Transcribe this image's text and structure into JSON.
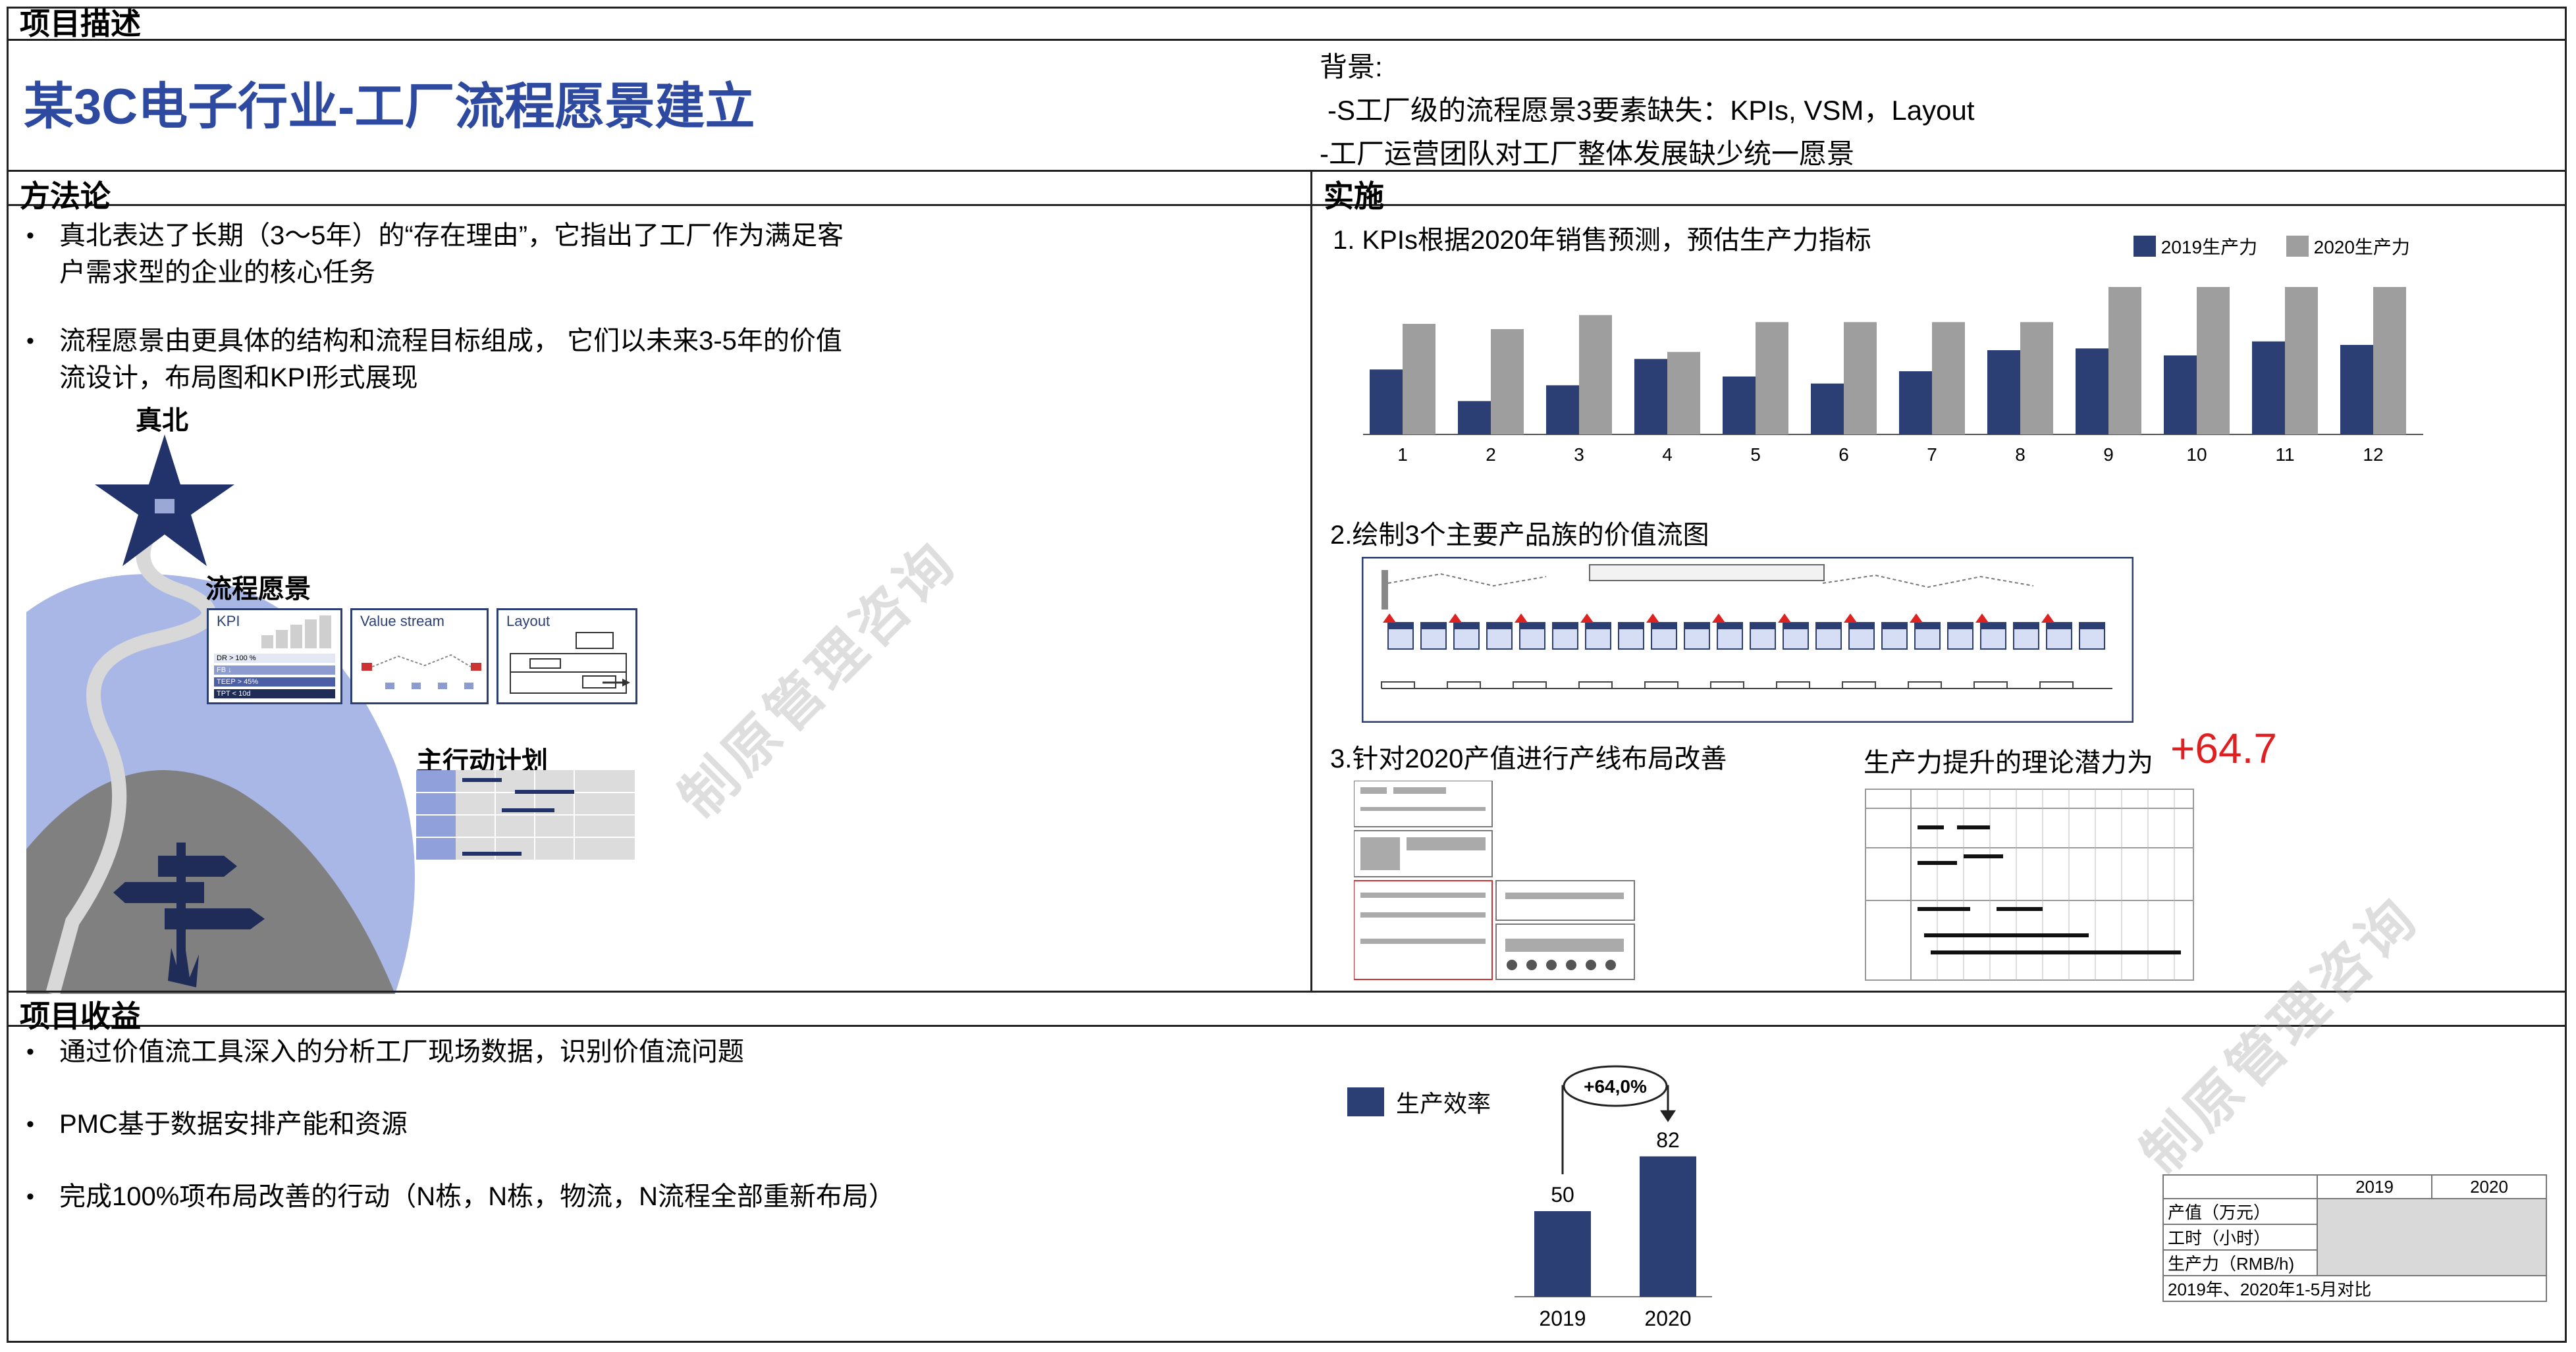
{
  "header": {
    "section_label": "项目描述",
    "title": "某3C电子行业-工厂流程愿景建立",
    "background_label": "背景:",
    "background_items": [
      "-S工厂级的流程愿景3要素缺失：KPIs, VSM，Layout",
      "-工厂运营团队对工厂整体发展缺少统一愿景"
    ]
  },
  "methodology": {
    "section_label": "方法论",
    "bullets": [
      "真北表达了长期（3～5年）的“存在理由”，它指出了工厂作为满足客户需求型的企业的核心任务",
      "流程愿景由更具体的结构和流程目标组成， 它们以未来3-5年的价值流设计，布局图和KPI形式展现"
    ],
    "true_north_label": "真北",
    "vision_label": "流程愿景",
    "vision_cards": [
      "KPI",
      "Value stream",
      "Layout"
    ],
    "kpi_rows": [
      "DR > 100 %",
      "FB ↓",
      "TEEP > 45%",
      "TPT < 10d"
    ],
    "action_plan_label": "主行动计划"
  },
  "implementation": {
    "section_label": "实施",
    "step1": "1. KPIs根据2020年销售预测，预估生产力指标",
    "step2": "2.绘制3个主要产品族的价值流图",
    "step3": "3.针对2020产值进行产线布局改善",
    "potential_label": "生产力提升的理论潜力为",
    "potential_value": "+64.7"
  },
  "chart_data": [
    {
      "type": "bar",
      "categories": [
        "1",
        "2",
        "3",
        "4",
        "5",
        "6",
        "7",
        "8",
        "9",
        "10",
        "11",
        "12"
      ],
      "series": [
        {
          "name": "2019生产力",
          "color": "#2b3f74",
          "values": [
            37,
            19,
            28,
            43,
            33,
            29,
            36,
            48,
            49,
            45,
            53,
            51
          ]
        },
        {
          "name": "2020生产力",
          "color": "#9e9e9e",
          "values": [
            63,
            60,
            68,
            47,
            64,
            64,
            64,
            64,
            84,
            84,
            84,
            84
          ]
        }
      ],
      "legend": "top-right"
    },
    {
      "type": "bar",
      "categories": [
        "2019",
        "2020"
      ],
      "series": [
        {
          "name": "生产效率",
          "color": "#2b3f74",
          "values": [
            50,
            82
          ]
        }
      ],
      "annotation": "+64,0%"
    }
  ],
  "benefits": {
    "section_label": "项目收益",
    "bullets": [
      "通过价值流工具深入的分析工厂现场数据，识别价值流问题",
      "PMC基于数据安排产能和资源",
      "完成100%项布局改善的行动（N栋，N栋，物流，N流程全部重新布局）"
    ],
    "table": {
      "headers": [
        "",
        "2019",
        "2020"
      ],
      "rows": [
        "产值（万元）",
        "工时（小时）",
        "生产力（RMB/h)"
      ],
      "footer": "2019年、2020年1-5月对比"
    }
  },
  "watermark": "制原管理咨询",
  "colors": {
    "accent_blue": "#2e4aa0",
    "bar_dark": "#2b3f74",
    "bar_grey": "#9e9e9e",
    "red": "#e02020"
  }
}
